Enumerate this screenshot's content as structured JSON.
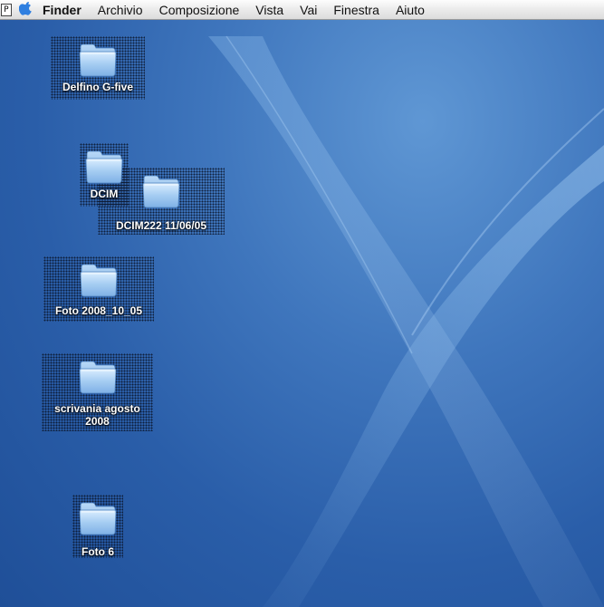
{
  "menubar": {
    "badge": "P",
    "app_name": "Finder",
    "items": [
      "Archivio",
      "Composizione",
      "Vista",
      "Vai",
      "Finestra",
      "Aiuto"
    ]
  },
  "desktop": {
    "icons": [
      {
        "label": "Delfino G-five"
      },
      {
        "label": "DCIM"
      },
      {
        "label": "DCIM222 11/06/05"
      },
      {
        "label": "Foto 2008_10_05"
      },
      {
        "label": "scrivania agosto\n2008"
      },
      {
        "label": "Foto 6"
      }
    ]
  },
  "colors": {
    "desktop_blue": "#2a5ea9",
    "folder_blue": "#9ec6ee",
    "apple_blue": "#2f7fe0"
  }
}
